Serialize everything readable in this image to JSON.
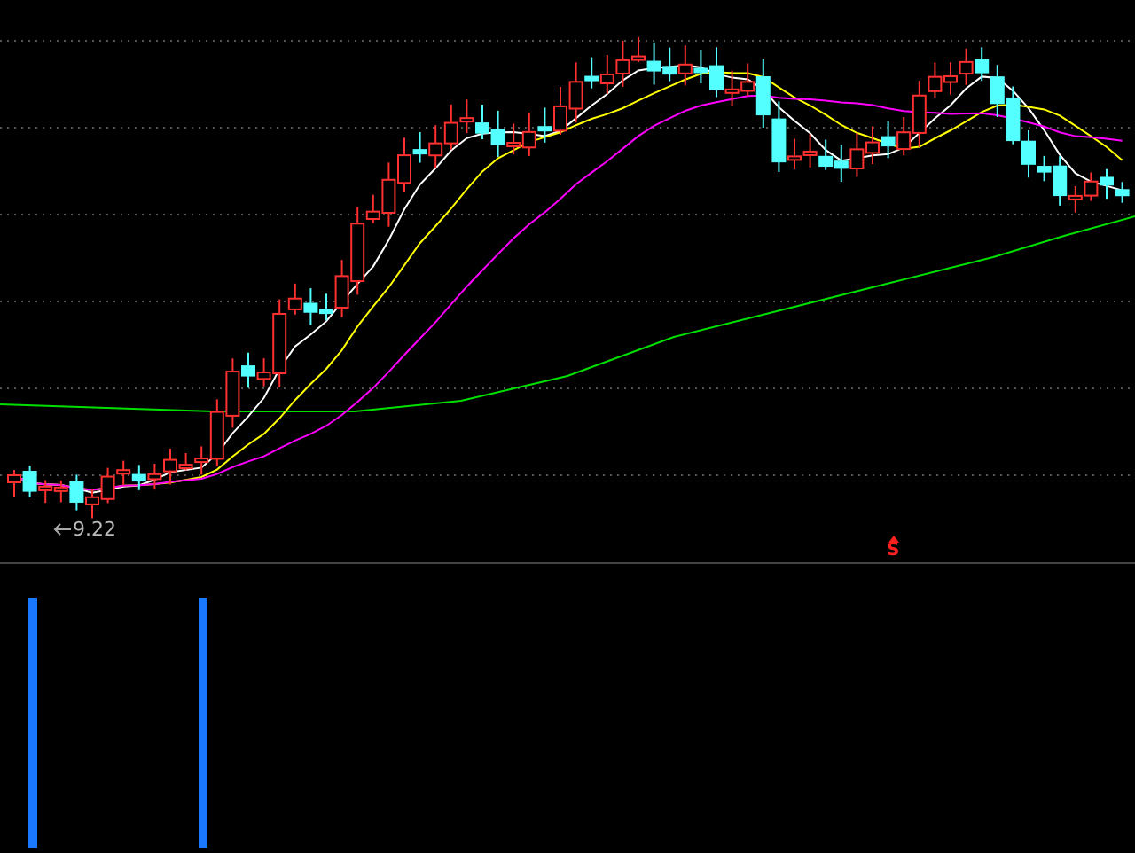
{
  "price_chart": {
    "low_label": "9.22",
    "signal_label": "S"
  }
}
